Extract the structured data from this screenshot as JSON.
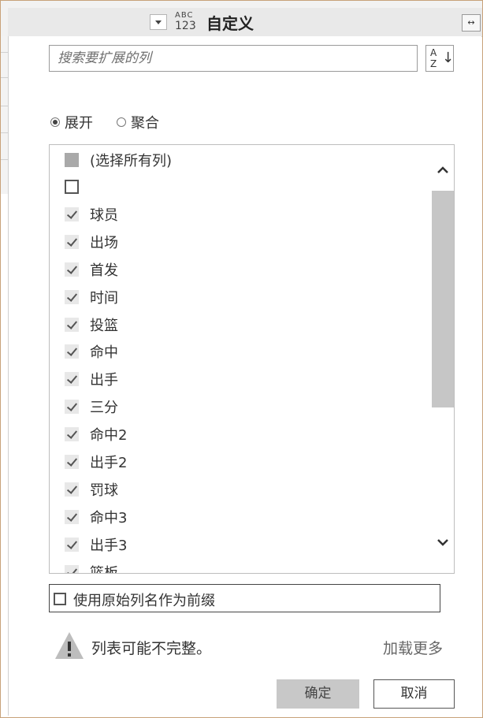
{
  "header": {
    "type_icon_top": "ABC",
    "type_icon_bottom": "123",
    "column_title": "自定义",
    "expand_icon": "expand-columns-icon"
  },
  "dialog": {
    "search_placeholder": "搜索要扩展的列",
    "sort_icon": "sort-az-icon",
    "sort_label_a": "A",
    "sort_label_z": "Z",
    "radio_expand": "展开",
    "radio_aggregate": "聚合",
    "selected_mode": "展开",
    "select_all": "(选择所有列)",
    "columns": [
      {
        "label": "",
        "checked": false
      },
      {
        "label": "球员",
        "checked": true
      },
      {
        "label": "出场",
        "checked": true
      },
      {
        "label": "首发",
        "checked": true
      },
      {
        "label": "时间",
        "checked": true
      },
      {
        "label": "投篮",
        "checked": true
      },
      {
        "label": "命中",
        "checked": true
      },
      {
        "label": "出手",
        "checked": true
      },
      {
        "label": "三分",
        "checked": true
      },
      {
        "label": "命中2",
        "checked": true
      },
      {
        "label": "出手2",
        "checked": true
      },
      {
        "label": "罚球",
        "checked": true
      },
      {
        "label": "命中3",
        "checked": true
      },
      {
        "label": "出手3",
        "checked": true
      },
      {
        "label": "篮板",
        "checked": true
      }
    ],
    "use_prefix_label": "使用原始列名作为前缀",
    "use_prefix_checked": false,
    "warning_text": "列表可能不完整。",
    "load_more": "加载更多",
    "ok_label": "确定",
    "cancel_label": "取消"
  },
  "colors": {
    "frame": "#c8a27a",
    "ok_button_bg": "#c8c8c8",
    "scroll_thumb": "#c6c6c6"
  }
}
